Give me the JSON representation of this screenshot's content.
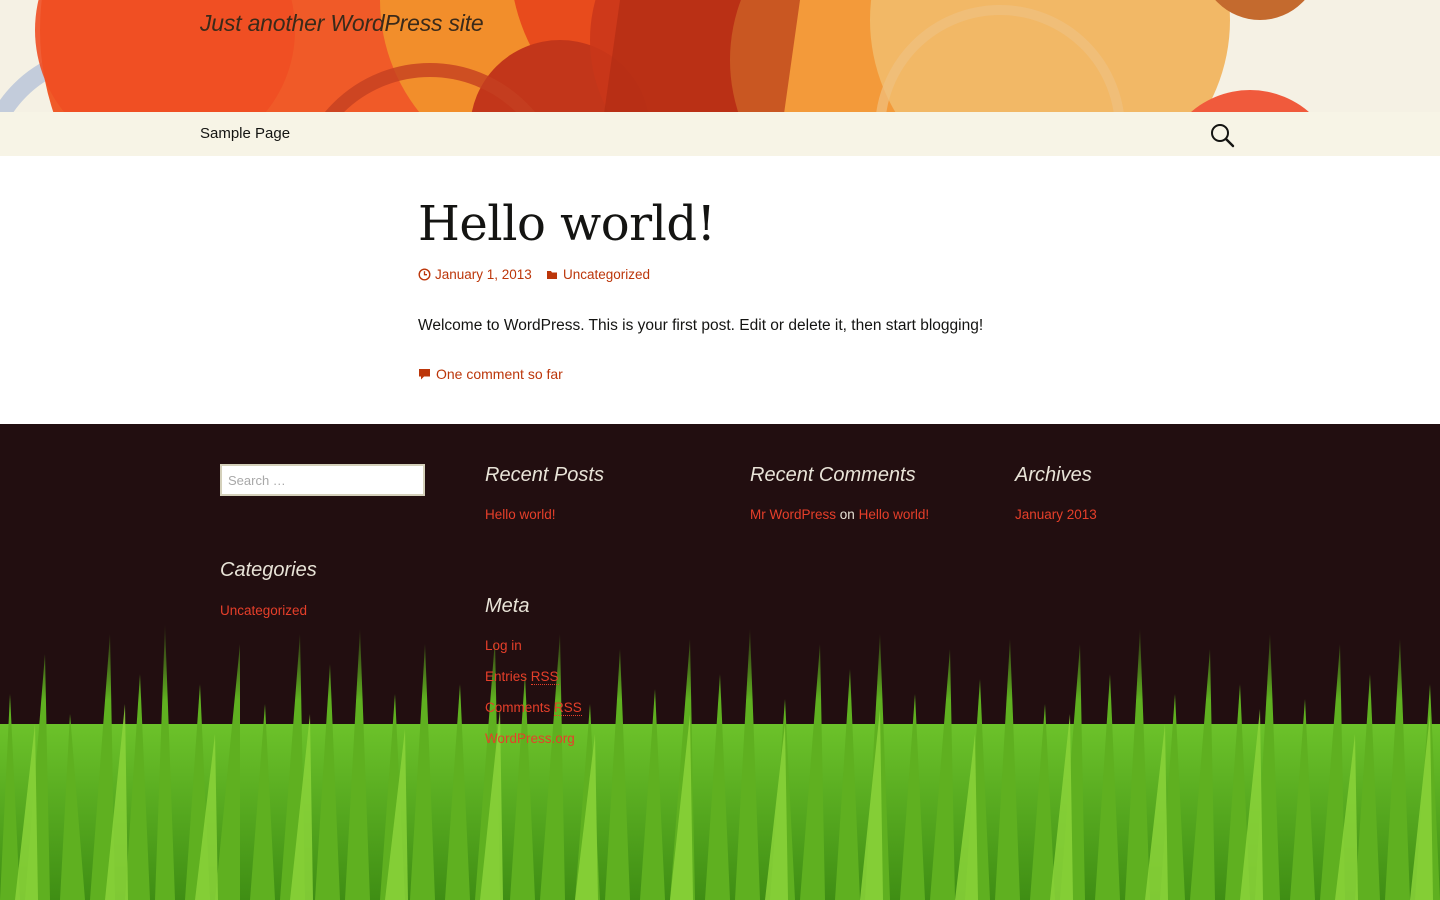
{
  "header": {
    "tagline": "Just another WordPress site"
  },
  "nav": {
    "items": [
      "Sample Page"
    ],
    "search_icon": "search-icon"
  },
  "post": {
    "title": "Hello world!",
    "date": "January 1, 2013",
    "category": "Uncategorized",
    "body": "Welcome to WordPress. This is your first post. Edit or delete it, then start blogging!",
    "comments_link": "One comment so far"
  },
  "footer": {
    "search_placeholder": "Search …",
    "categories": {
      "title": "Categories",
      "items": [
        "Uncategorized"
      ]
    },
    "recent_posts": {
      "title": "Recent Posts",
      "items": [
        "Hello world!"
      ]
    },
    "meta": {
      "title": "Meta",
      "log_in": "Log in",
      "entries_a": "Entries ",
      "entries_b": "RSS",
      "comments_a": "Comments ",
      "comments_b": "RSS",
      "wordpress_org": "WordPress.org"
    },
    "recent_comments": {
      "title": "Recent Comments",
      "author": "Mr WordPress",
      "on": "on",
      "post": "Hello world!"
    },
    "archives": {
      "title": "Archives",
      "items": [
        "January 2013"
      ]
    }
  },
  "colors": {
    "accent": "#bc360a",
    "footer_bg": "#220e10",
    "footer_link": "#e63f2a",
    "nav_bg": "#f7f4e6"
  }
}
